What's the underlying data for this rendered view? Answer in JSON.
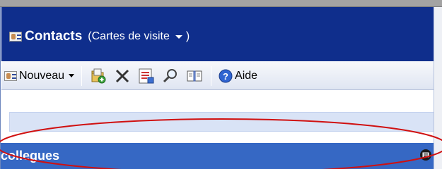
{
  "header": {
    "title": "Contacts",
    "view_label": "(Cartes de visite",
    "view_close": ")"
  },
  "toolbar": {
    "new_label": "Nouveau",
    "help_label": "Aide"
  },
  "group": {
    "label": "collegues"
  },
  "colors": {
    "header_bg": "#0f2e8c",
    "group_bg": "#3668c4",
    "annotation": "#d01010"
  }
}
